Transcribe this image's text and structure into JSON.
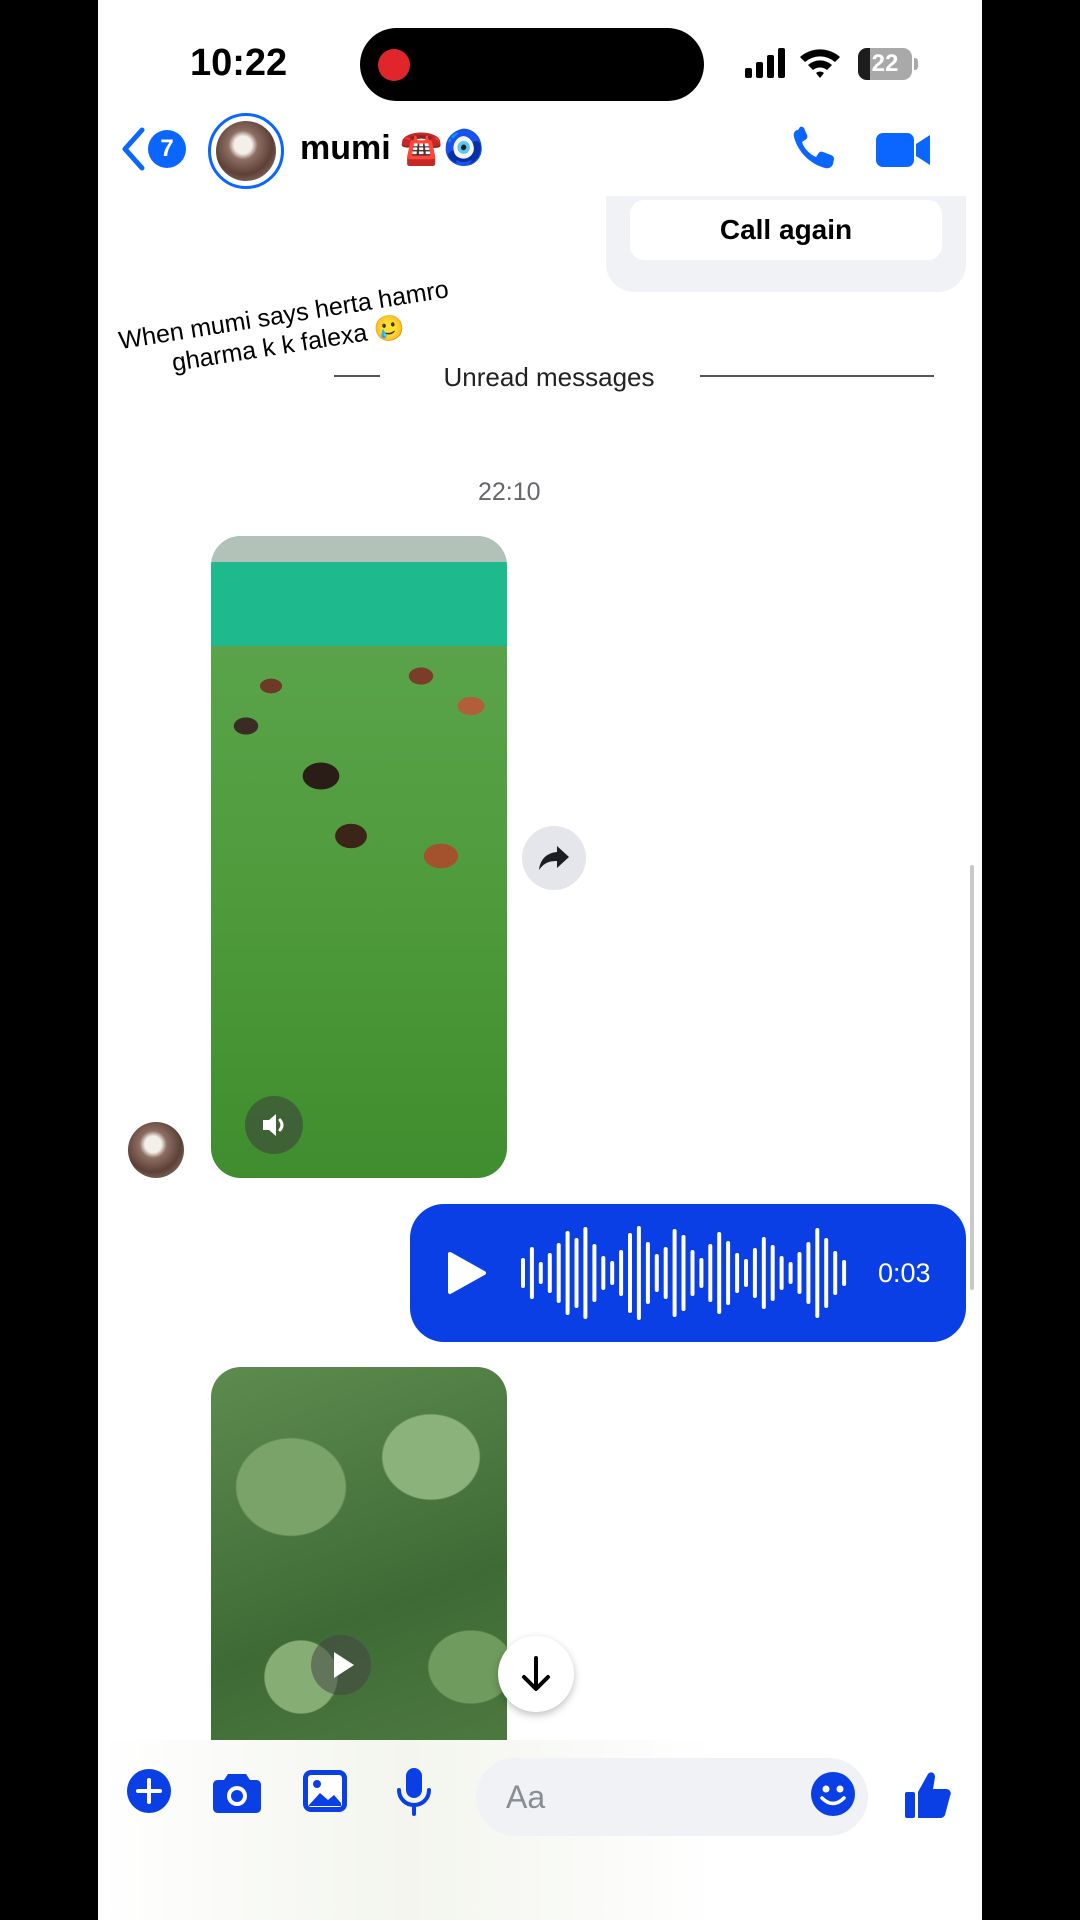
{
  "status_bar": {
    "time": "10:22",
    "battery_level": "22",
    "battery_fraction": 0.22,
    "icons": [
      "recording-dot",
      "signal-icon",
      "wifi-icon",
      "battery-icon"
    ]
  },
  "header": {
    "back_badge": "7",
    "contact_name": "mumi ☎️🧿",
    "icons": [
      "back-chevron-icon",
      "avatar",
      "phone-icon",
      "video-camera-icon"
    ]
  },
  "call_card": {
    "button_label": "Call again"
  },
  "overlay_caption": "When mumi says herta hamro gharma k k falexa 🥲",
  "unread_divider": "Unread messages",
  "timestamp": "22:10",
  "voice_message": {
    "duration": "0:03",
    "icons": [
      "play-icon",
      "waveform"
    ]
  },
  "composer": {
    "placeholder": "Aa",
    "icons": [
      "plus-icon",
      "camera-icon",
      "gallery-icon",
      "microphone-icon",
      "emoji-icon",
      "thumbs-up-icon"
    ]
  },
  "colors": {
    "accent": "#0a66ff",
    "voice_bubble": "#0a3fe6",
    "composer_icons": "#0a3fe6"
  }
}
